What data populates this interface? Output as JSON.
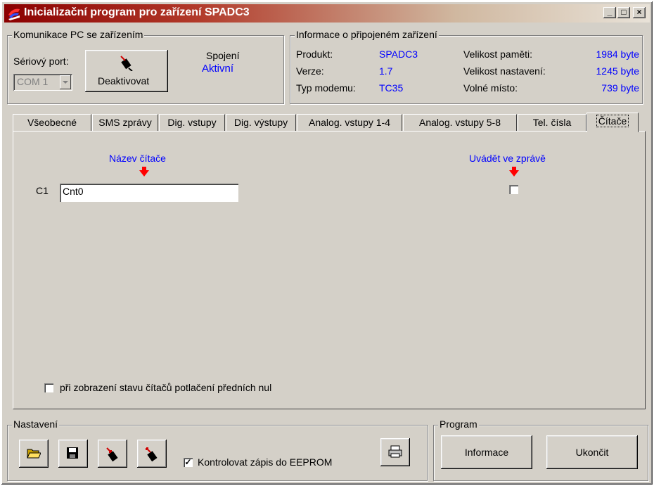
{
  "window": {
    "title": "Inicializační program pro zařízení SPADC3",
    "min_btn": "_",
    "max_btn": "□",
    "close_btn": "×"
  },
  "comm": {
    "group_title": "Komunikace PC se zařízením",
    "port_label": "Sériový port:",
    "port_value": "COM 1",
    "connection_label": "Spojení",
    "connection_status": "Aktivní",
    "deactivate_label": "Deaktivovat"
  },
  "info": {
    "group_title": "Informace o připojeném zařízení",
    "rows": [
      {
        "label": "Produkt:",
        "value": "SPADC3",
        "label2": "Velikost paměti:",
        "value2": "1984 byte"
      },
      {
        "label": "Verze:",
        "value": "1.7",
        "label2": "Velikost nastavení:",
        "value2": "1245 byte"
      },
      {
        "label": "Typ modemu:",
        "value": "TC35",
        "label2": "Volné místo:",
        "value2": "739 byte"
      }
    ]
  },
  "tabs": [
    "Všeobecné",
    "SMS zprávy",
    "Dig. vstupy",
    "Dig. výstupy",
    "Analog. vstupy 1-4",
    "Analog. vstupy 5-8",
    "Tel. čísla",
    "Čítače"
  ],
  "counters": {
    "name_header": "Název čítače",
    "report_header": "Uvádět ve zprávě",
    "row_label": "C1",
    "row_value": "Cnt0",
    "report_checked": false,
    "suppress_zeros_label": "při zobrazení stavu čítačů potlačení předních nul",
    "suppress_zeros_checked": false
  },
  "settings": {
    "group_title": "Nastavení",
    "eeprom_label": "Kontrolovat zápis do EEPROM",
    "eeprom_checked": true,
    "check_mark": "✓",
    "icons": [
      "open-folder-icon",
      "save-disk-icon",
      "upload-icon",
      "download-icon",
      "printer-icon"
    ]
  },
  "program": {
    "group_title": "Program",
    "info_button": "Informace",
    "quit_button": "Ukončit"
  },
  "colors": {
    "face": "#d4d0c8",
    "accent_blue": "#0000ff",
    "arrow_red": "#ff0000"
  }
}
